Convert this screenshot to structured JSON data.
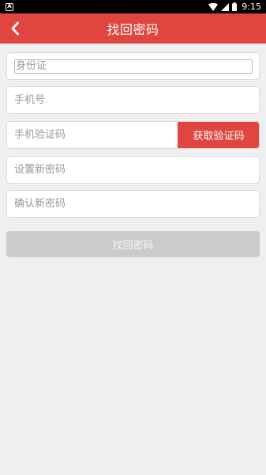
{
  "status_bar": {
    "time": "9:15",
    "sim_icon": "sim-card-icon",
    "icons": [
      "wifi-icon",
      "signal-icon",
      "battery-icon"
    ]
  },
  "header": {
    "title": "找回密码",
    "back_icon": "chevron-left-icon",
    "background_color": "#e0463f"
  },
  "form": {
    "id_card_placeholder": "身份证",
    "phone_placeholder": "手机号",
    "sms_code_placeholder": "手机验证码",
    "get_code_label": "获取验证码",
    "new_password_placeholder": "设置新密码",
    "confirm_password_placeholder": "确认新密码",
    "submit_label": "找回密码"
  },
  "colors": {
    "accent": "#e0463f",
    "disabled_button": "#cbcbcb",
    "background": "#efefef"
  }
}
